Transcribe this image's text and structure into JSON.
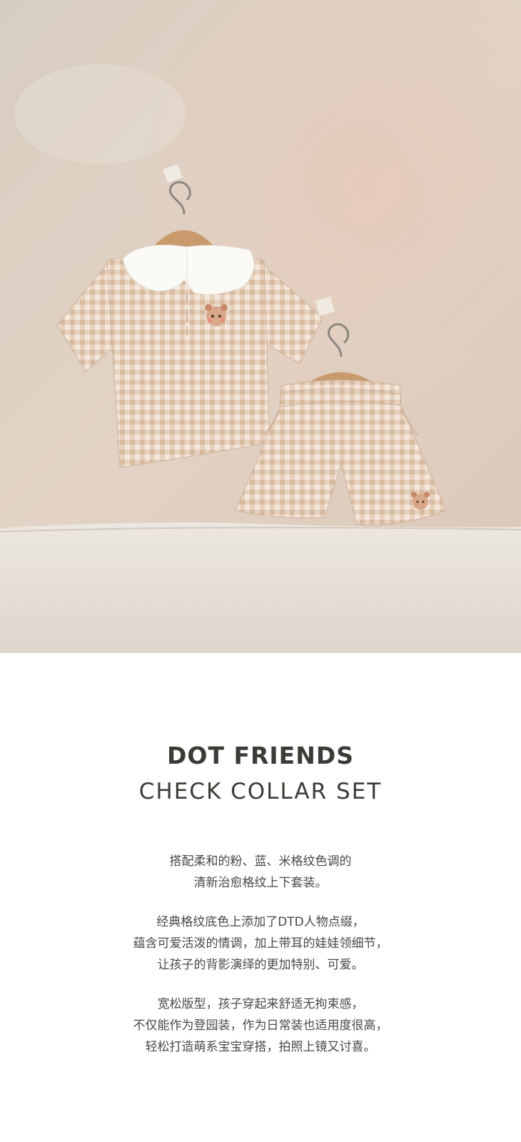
{
  "product": {
    "title": "DOT FRIENDS",
    "subtitle": "CHECK COLLAR SET"
  },
  "description": {
    "paragraphs": [
      [
        "搭配柔和的粉、蓝、米格纹色调的",
        "清新治愈格纹上下套装。"
      ],
      [
        "经典格纹底色上添加了DTD人物点缀，",
        "蕴含可爱活泼的情调，加上带耳的娃娃领细节，",
        "让孩子的背影演绎的更加特别、可爱。"
      ],
      [
        "宽松版型，孩子穿起来舒适无拘束感，",
        "不仅能作为登园装，作为日常装也适用度很高，",
        "轻松打造萌系宝宝穿搭，拍照上镜又讨喜。"
      ]
    ]
  },
  "colors": {
    "wall": "#ddd0c2",
    "fabric_check": "#d9bda6",
    "collar": "#fbfaf5",
    "hanger_wood": "#c89a6c",
    "text": "#3d3b36"
  }
}
